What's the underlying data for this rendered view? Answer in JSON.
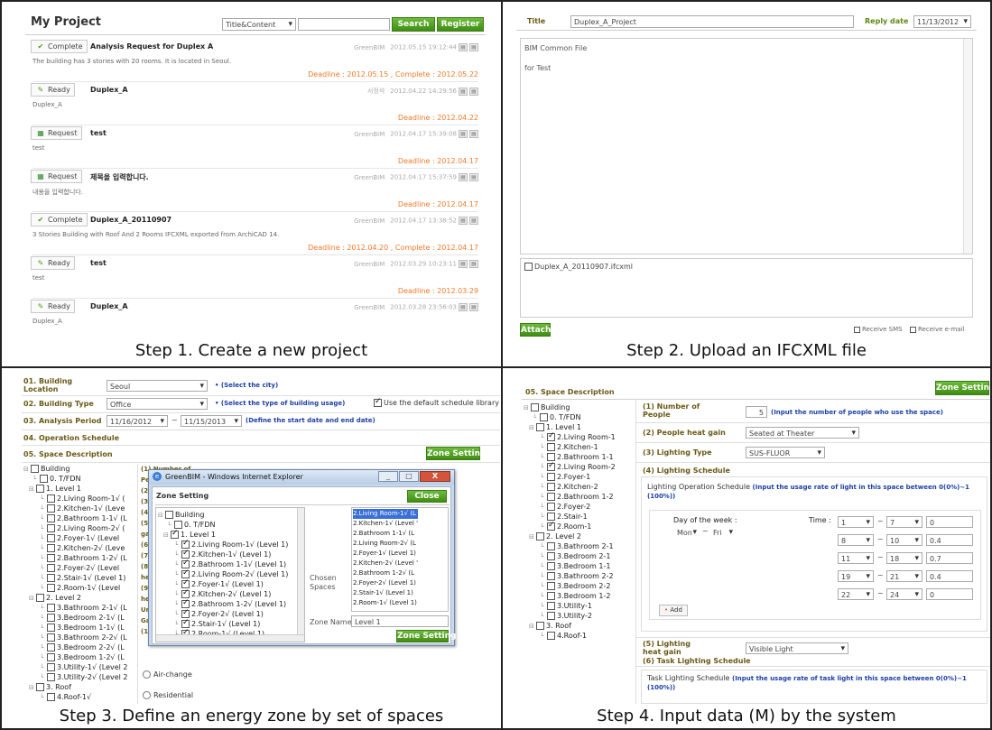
{
  "captions": [
    "Step 1. Create a new project",
    "Step 2. Upload an IFCXML file",
    "Step 3. Define an energy zone by set of spaces",
    "Step 4. Input data (M) by the system"
  ],
  "p1": {
    "title": "My Project",
    "filter": "Title&Content",
    "search": "Search",
    "register": "Register",
    "items": [
      {
        "status": "Complete",
        "icon": "✔",
        "title": "Analysis Request for Duplex A",
        "author": "GreenBIM",
        "date": "2012.05.15 19:12:44",
        "desc": "The building has 3 stories with 20 rooms. It is located in Seoul.",
        "deadline": "Deadline : 2012.05.15 , Complete : 2012.05.22"
      },
      {
        "status": "Ready",
        "icon": "✎",
        "title": "Duplex_A",
        "author": "서정석",
        "date": "2012.04.22 14:29:56",
        "desc": "Duplex_A",
        "deadline": "Deadline : 2012.04.22"
      },
      {
        "status": "Request",
        "icon": "▦",
        "title": "test",
        "author": "GreenBIM",
        "date": "2012.04.17 15:39:08",
        "desc": "test",
        "deadline": "Deadline : 2012.04.17"
      },
      {
        "status": "Request",
        "icon": "▦",
        "title": "제목을 입력합니다.",
        "author": "GreenBIM",
        "date": "2012.04.17 15:37:59",
        "desc": "내용을 입력합니다.",
        "deadline": "Deadline : 2012.04.17"
      },
      {
        "status": "Complete",
        "icon": "✔",
        "title": "Duplex_A_20110907",
        "author": "GreenBIM",
        "date": "2012.04.17 13:38:52",
        "desc": "3 Stories Building with Roof And 2 Rooms IFCXML exported from ArchiCAD 14.",
        "deadline": "Deadline : 2012.04.20 , Complete : 2012.04.17"
      },
      {
        "status": "Ready",
        "icon": "✎",
        "title": "test",
        "author": "GreenBIM",
        "date": "2012.03.29 10:23:11",
        "desc": "test",
        "deadline": "Deadline : 2012.03.29"
      },
      {
        "status": "Ready",
        "icon": "✎",
        "title": "Duplex_A",
        "author": "GreenBIM",
        "date": "2012.03.28 23:56:03",
        "desc": "Duplex_A",
        "deadline": ""
      }
    ]
  },
  "p2": {
    "title_label": "Title",
    "title_value": "Duplex_A_Project",
    "reply_label": "Reply date",
    "reply_value": "11/13/2012",
    "body": [
      "BIM Common File",
      "for Test"
    ],
    "file": "Duplex_A_20110907.ifcxml",
    "attach": "Attach",
    "sms": "Receive SMS",
    "email": "Receive e-mail"
  },
  "p3": {
    "rows": [
      {
        "label": "01. Building Location",
        "value": "Seoul",
        "hint": "• (Select the city)"
      },
      {
        "label": "02. Building Type",
        "value": "Office",
        "hint": "• (Select the type of building usage)"
      },
      {
        "label": "03. Analysis Period",
        "value": "11/16/2012",
        "value2": "11/15/2013",
        "hint": "(Define the start date and end date)"
      },
      {
        "label": "04. Operation Schedule"
      },
      {
        "label": "05. Space Description"
      }
    ],
    "default_schedule": "Use the default schedule library",
    "zone_setting": "Zone Setting",
    "tree": [
      "Building",
      "0. T/FDN",
      "1. Level 1",
      "2.Living Room-1√ (",
      "2.Kitchen-1√ (Leve",
      "2.Bathroom 1-1√ (L",
      "2.Living Room-2√ (",
      "2.Foyer-1√ (Level",
      "2.Kitchen-2√ (Leve",
      "2.Bathroom 1-2√ (L",
      "2.Foyer-2√ (Level",
      "2.Stair-1√ (Level 1)",
      "2.Room-1√ (Level",
      "2. Level 2",
      "3.Bathroom 2-1√ (L",
      "3.Bedroom 2-1√ (L",
      "3.Bedroom 1-1√ (L",
      "3.Bathroom 2-2√ (L",
      "3.Bedroom 2-2√ (L",
      "3.Bedroom 1-2√ (L",
      "3.Utility-1√ (Level 2",
      "3.Utility-2√ (Level 2",
      "3. Roof",
      "4.Roof-1√"
    ],
    "bg_lines": [
      "(1) Number of",
      "Pe",
      "(2",
      "(3",
      "(4",
      "(5",
      "gai",
      "(6",
      "(7",
      "(8",
      "he",
      "(9",
      "he",
      "Un",
      "Ga",
      "(1"
    ],
    "air_change": "Air-change",
    "residential": "Residential",
    "dialog": {
      "title": "GreenBIM - Windows Internet Explorer",
      "heading": "Zone Setting",
      "close": "Close",
      "tree": [
        "Building",
        "0. T/FDN",
        "1. Level 1",
        "2.Living Room-1√ (Level 1)",
        "2.Kitchen-1√ (Level 1)",
        "2.Bathroom 1-1√ (Level 1)",
        "2.Living Room-2√ (Level 1)",
        "2.Foyer-1√ (Level 1)",
        "2.Kitchen-2√ (Level 1)",
        "2.Bathroom 1-2√ (Level 1)",
        "2.Foyer-2√ (Level 1)",
        "2.Stair-1√ (Level 1)",
        "2.Room-1√ (Level 1)"
      ],
      "chosen_label": "Chosen Spaces",
      "chosen": [
        "2.Living Room-1√ (L",
        "2.Kitchen-1√ (Level '",
        "2.Bathroom 1-1√ (L",
        "2.Living Room-2√ (L",
        "2.Foyer-1√ (Level 1)",
        "2.Kitchen-2√ (Level '",
        "2.Bathroom 1-2√ (L",
        "2.Foyer-2√ (Level 1)",
        "2.Stair-1√ (Level 1)",
        "2.Room-1√ (Level 1)"
      ],
      "zone_name_label": "Zone Name",
      "zone_name": "Level 1",
      "zone_setting": "Zone Setting"
    }
  },
  "p4": {
    "section": "05. Space Description",
    "zone_setting": "Zone Setting",
    "tree": [
      "Building",
      "0. T/FDN",
      "1. Level 1",
      "2.Living Room-1",
      "2.Kitchen-1",
      "2.Bathroom 1-1",
      "2.Living Room-2",
      "2.Foyer-1",
      "2.Kitchen-2",
      "2.Bathroom 1-2",
      "2.Foyer-2",
      "2.Stair-1",
      "2.Room-1",
      "2. Level 2",
      "3.Bathroom 2-1",
      "3.Bedroom 2-1",
      "3.Bedroom 1-1",
      "3.Bathroom 2-2",
      "3.Bedroom 2-2",
      "3.Bedroom 1-2",
      "3.Utility-1",
      "3.Utility-2",
      "3. Roof",
      "4.Roof-1"
    ],
    "people_label": "(1) Number of People",
    "people_value": "5",
    "people_hint": "(Input the number of people who use the space)",
    "heat_label": "(2) People heat gain",
    "heat_value": "Seated at Theater",
    "light_type_label": "(3) Lighting Type",
    "light_type_value": "SUS-FLUOR",
    "light_sched_label": "(4) Lighting Schedule",
    "op_title": "Lighting Operation Schedule",
    "op_hint": "(Input the usage rate of light in this space between 0(0%)~1 (100%))",
    "dow_label": "Day of the week :",
    "dow_from": "Mon",
    "dow_to": "Fri",
    "time_label": "Time :",
    "times": [
      [
        "1",
        "7",
        "0"
      ],
      [
        "8",
        "10",
        "0.4"
      ],
      [
        "11",
        "18",
        "0.7"
      ],
      [
        "19",
        "21",
        "0.4"
      ],
      [
        "22",
        "24",
        "0"
      ]
    ],
    "add": "Add",
    "light_heat_label": "(5) Lighting heat gain",
    "light_heat_value": "Visible Light",
    "task_label": "(6) Task Lighting Schedule",
    "task_title": "Task Lighting Schedule",
    "task_hint": "(Input the usage rate of task light in this space between 0(0%)~1 (100%))"
  }
}
